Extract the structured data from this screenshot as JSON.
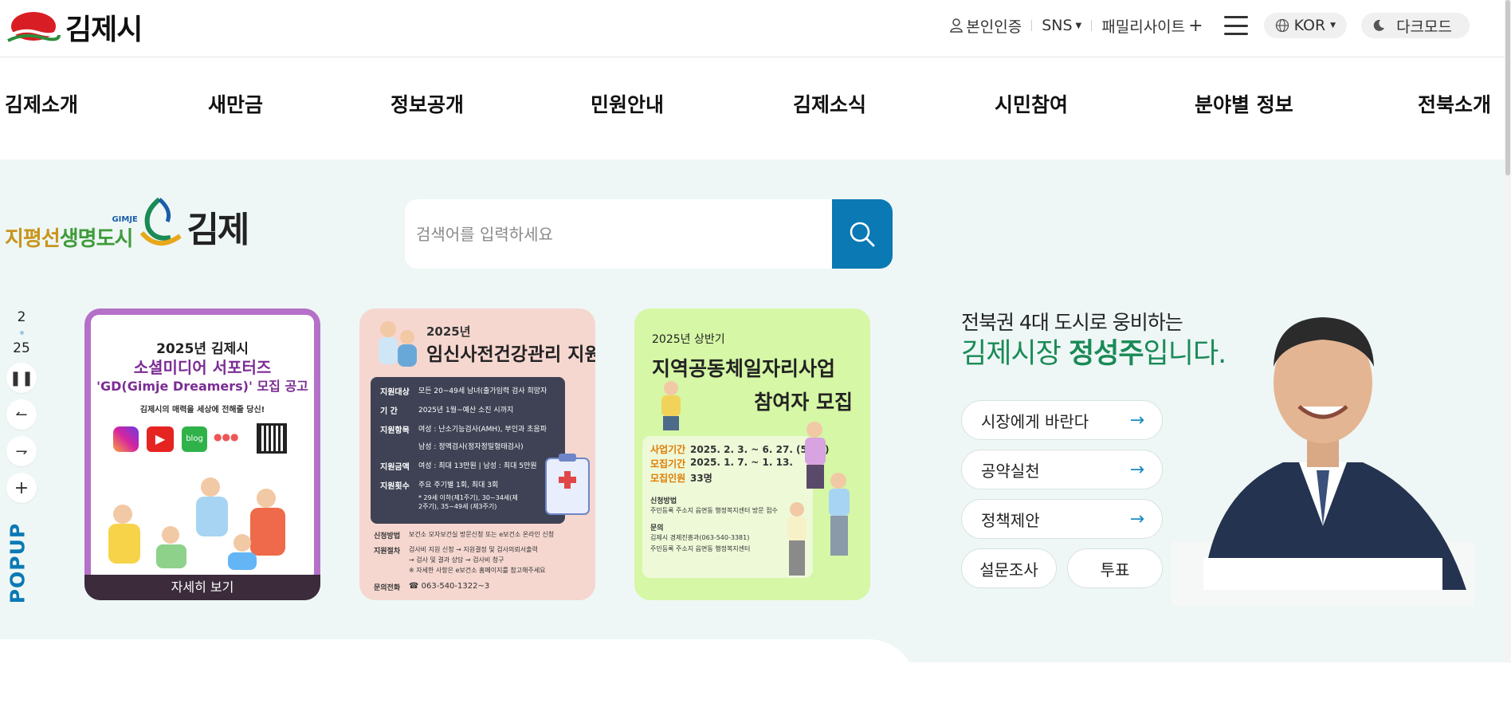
{
  "header": {
    "logo_text": "김제시",
    "util": {
      "verify": "본인인증",
      "sns": "SNS",
      "family": "패밀리사이트",
      "lang": "KOR",
      "dark": "다크모드"
    }
  },
  "nav": [
    "김제소개",
    "새만금",
    "정보공개",
    "민원안내",
    "김제소식",
    "시민참여",
    "분야별 정보",
    "전북소개"
  ],
  "slogan": {
    "part1": "지평선",
    "part2": "생명도시",
    "en": "GIMJE",
    "city": "김제"
  },
  "search": {
    "placeholder": "검색어를 입력하세요"
  },
  "popup": {
    "current": "2",
    "total": "25",
    "label": "POPUP"
  },
  "cards": [
    {
      "title1": "2025년 김제시",
      "title2": "소셜미디어 서포터즈",
      "title3": "'GD(Gimje Dreamers)' 모집 공고",
      "sub": "김제시의 매력을 세상에 전해줄 당신!",
      "more": "자세히 보기"
    },
    {
      "year": "2025년",
      "title": "임신사전건강관리 지원",
      "rows": [
        {
          "k": "지원대상",
          "v": "모든 20~49세 남녀(출가임력 검사 희망자"
        },
        {
          "k": "기    간",
          "v": "2025년 1월~예산 소진 시까지"
        },
        {
          "k": "지원항목",
          "v": "여성 : 난소기능검사(AMH), 부인과 초음파"
        },
        {
          "k": "",
          "v": "남성 : 정액검사(정자정밀형태검사)"
        },
        {
          "k": "지원금액",
          "v": "여성 : 최대 13만원  |  남성 : 최대 5만원"
        },
        {
          "k": "지원횟수",
          "v": "주요 주기별 1회, 최대 3회"
        }
      ],
      "note": "* 29세 이하(제1주기), 30~34세(제 2주기), 35~49세 (제3주기)",
      "apply_k": "신청방법",
      "apply_v": "보건소 모자보건실 방문신청 또는 e보건소 온라인 신청",
      "proc_k": "지원절차",
      "proc_v1": "검사비 지원 신청 → 지원결정 및 검사의뢰서출력",
      "proc_v2": "→ 검사 및 결과 상담 → 검사비 청구",
      "proc_v3": "※ 자세한 사항은 e보건소 홈페이지를 참고해주세요",
      "tel_k": "문의전화",
      "tel_v": "☎ 063-540-1322~3"
    },
    {
      "year": "2025년 상반기",
      "title1": "지역공동체일자리사업",
      "title2": "참여자 모집",
      "rows": [
        {
          "k": "사업기간",
          "v": "2025. 2. 3. ~ 6. 27. (5개월)"
        },
        {
          "k": "모집기간",
          "v": "2025. 1. 7. ~ 1. 13."
        },
        {
          "k": "모집인원",
          "v": "33명"
        }
      ],
      "apply_k": "신청방법",
      "apply_v": "주민등록 주소지 읍면동 행정복지센터 방문 접수",
      "ask_k": "문의",
      "ask_v1": "김제시 경제진흥과(063-540-3381)",
      "ask_v2": "주민등록 주소지 읍면동 행정복지센터"
    }
  ],
  "mayor": {
    "line1": "전북권 4대 도시로 웅비하는",
    "line2_a": "김제시장 ",
    "line2_b": "정성주",
    "line2_c": "입니다.",
    "buttons": [
      "시장에게 바란다",
      "공약실천",
      "정책제안"
    ],
    "small_buttons": [
      "설문조사",
      "투표"
    ]
  },
  "colors": {
    "brand_blue": "#0a79b4",
    "green": "#1a8a56",
    "bg_mint": "#eef7f6"
  }
}
